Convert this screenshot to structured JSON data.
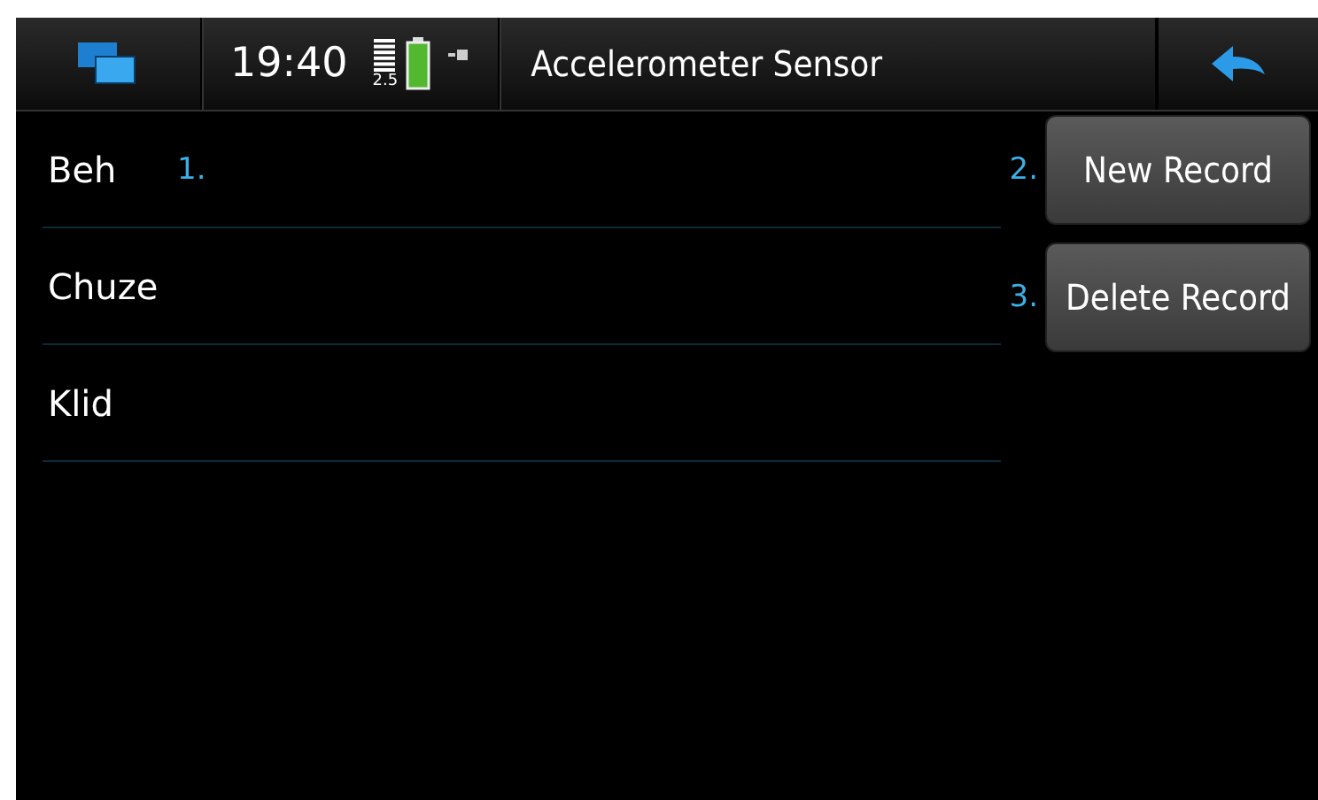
{
  "status_bar": {
    "time": "19:40",
    "signal_label": "2.5",
    "title": "Accelerometer Sensor"
  },
  "list": {
    "items": [
      {
        "label": "Beh",
        "note": "1."
      },
      {
        "label": "Chuze"
      },
      {
        "label": "Klid"
      }
    ]
  },
  "buttons": [
    {
      "label": "New Record",
      "note": "2."
    },
    {
      "label": "Delete Record",
      "note": "3."
    }
  ]
}
